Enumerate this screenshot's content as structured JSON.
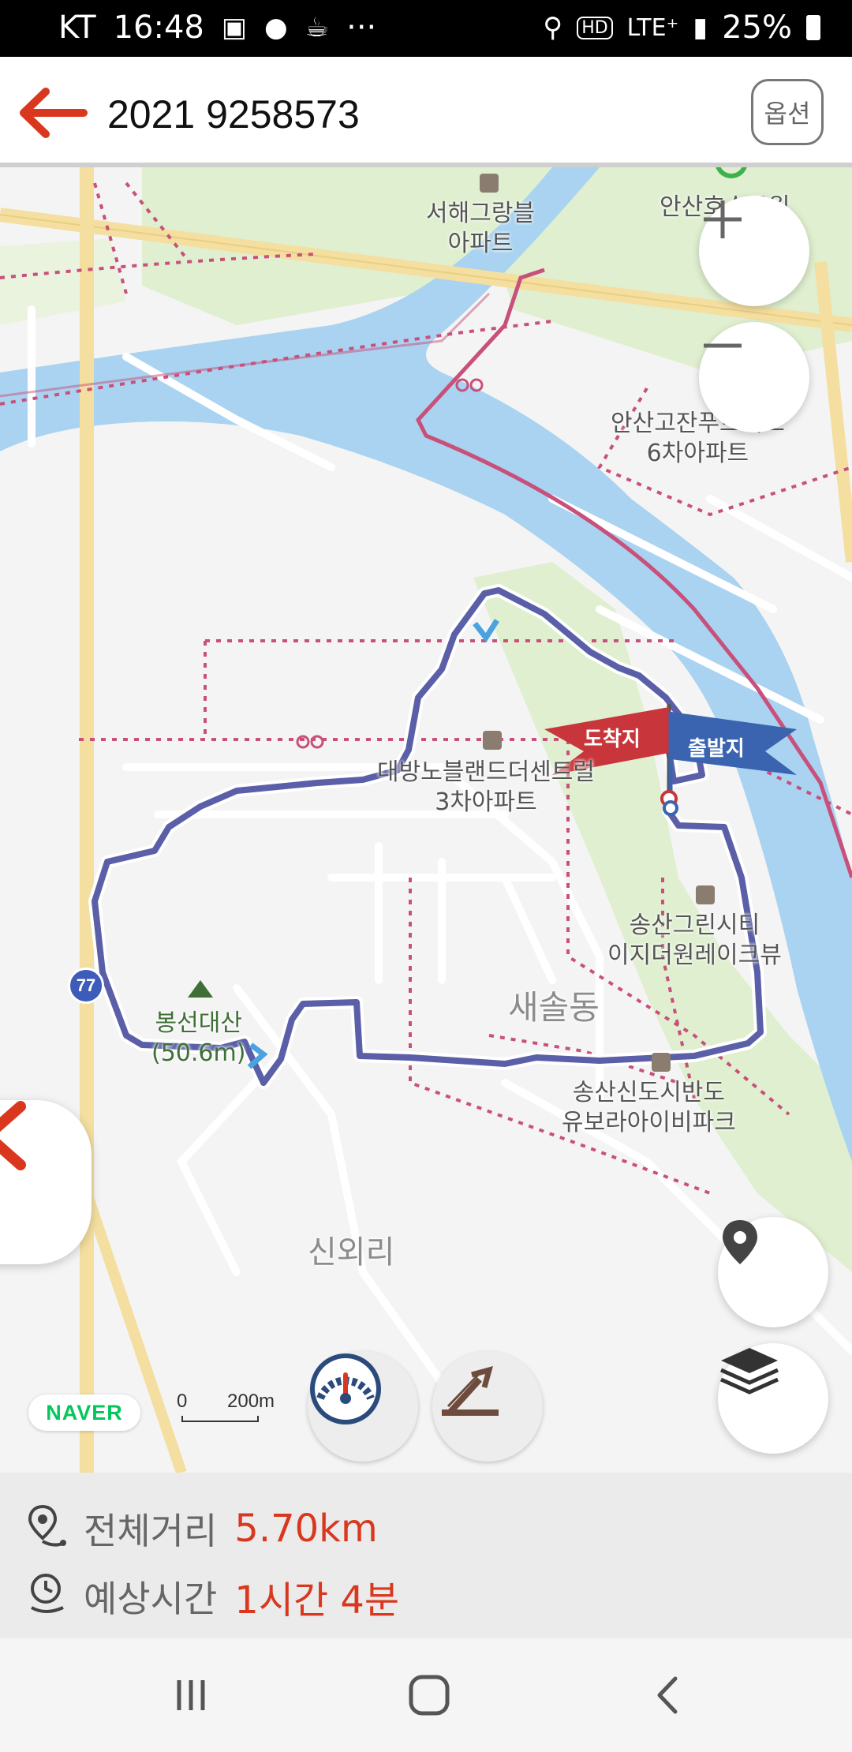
{
  "status_bar": {
    "carrier": "KT",
    "time": "16:48",
    "more": "···",
    "network": "LTE⁺",
    "battery": "25%"
  },
  "header": {
    "title": "2021 9258573",
    "options_label": "옵션"
  },
  "map": {
    "labels": {
      "apt_seohae": "서해그랑블\n아파트",
      "park_top": "안산호수공원",
      "apt_ansan_gojan": "안산고잔푸르지오\n6차아파트",
      "apt_daewoo": "대방노블랜드더센트럴\n3차아파트",
      "apt_songsan_green": "송산그린시티\n이지더원레이크뷰",
      "district_saesol": "새솔동",
      "apt_songsan_bando": "송산신도시반도\n유보라아이비파크",
      "mountain": "봉선대산\n(50.6m)",
      "district_sinoe": "신외리",
      "road_number": "77"
    },
    "flag_arrival": "도착지",
    "flag_departure": "출발지",
    "naver_logo": "NAVER",
    "scale_zero": "0",
    "scale_value": "200m",
    "icons": {
      "zoom_in": "plus-icon",
      "zoom_out": "minus-icon",
      "collapse": "chevron-left-icon",
      "location": "location-pin-icon",
      "layers": "layers-icon",
      "speedometer": "speedometer-icon",
      "elevation": "elevation-icon"
    },
    "colors": {
      "route": "#5a5fa8",
      "river": "#a9d3f0",
      "bike_path": "#c8507a",
      "road": "#f4dfa0",
      "park": "#dfefd0",
      "arrival_flag": "#c8353a",
      "departure_flag": "#3b64b0"
    }
  },
  "summary": {
    "distance_label": "전체거리",
    "distance_value": "5.70km",
    "time_label": "예상시간",
    "time_value": "1시간 4분"
  },
  "nav_bar": {
    "recents": "recents-icon",
    "home": "home-icon",
    "back": "back-icon"
  }
}
